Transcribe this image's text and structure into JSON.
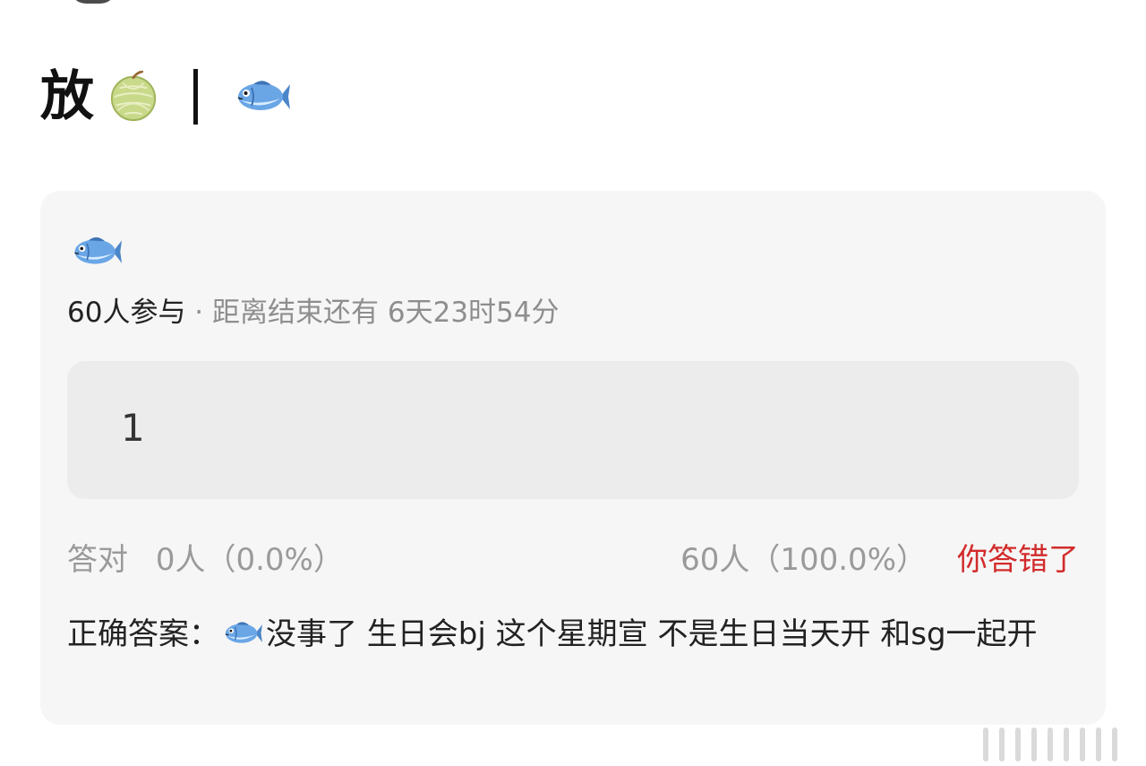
{
  "header": {
    "title_char": "放",
    "separator": "|",
    "emoji_1": "melon-emoji",
    "emoji_2": "fish-emoji"
  },
  "poll": {
    "question_emoji": "fish-emoji",
    "participants": "60人参与",
    "dot": " · ",
    "countdown": "距离结束还有 6天23时54分",
    "answer_value": "1",
    "stats": {
      "correct_label": "答对",
      "correct_count": "0人（0.0%）",
      "wrong_count": "60人（100.0%）",
      "wrong_label": "你答错了"
    },
    "correct_answer_label": "正确答案：",
    "correct_answer_text": "没事了 生日会bj 这个星期宣 不是生日当天开 和sg一起开"
  },
  "colors": {
    "card_background": "#f6f6f6",
    "answer_box": "#ececec",
    "wrong_red": "#d22b2b",
    "muted_text": "#9a9a9a"
  }
}
